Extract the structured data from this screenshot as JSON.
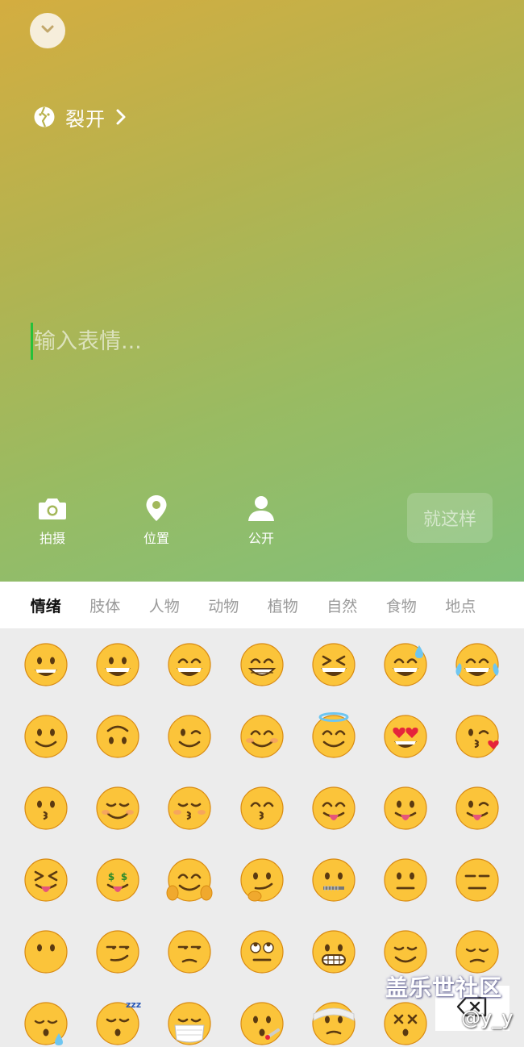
{
  "header": {
    "mood_name": "裂开"
  },
  "input": {
    "placeholder": "输入表情..."
  },
  "toolbar": {
    "camera_label": "拍摄",
    "location_label": "位置",
    "visibility_label": "公开",
    "submit_label": "就这样"
  },
  "tabs": [
    {
      "label": "情绪",
      "active": true
    },
    {
      "label": "肢体",
      "active": false
    },
    {
      "label": "人物",
      "active": false
    },
    {
      "label": "动物",
      "active": false
    },
    {
      "label": "植物",
      "active": false
    },
    {
      "label": "自然",
      "active": false
    },
    {
      "label": "食物",
      "active": false
    },
    {
      "label": "地点",
      "active": false
    }
  ],
  "emoji_rows": [
    [
      "grinning",
      "smiley",
      "smile",
      "grin",
      "laughing",
      "sweat-smile",
      "joy"
    ],
    [
      "slightly-smiling",
      "upside-down",
      "wink",
      "blush",
      "innocent",
      "heart-eyes",
      "kissing-heart"
    ],
    [
      "kissing",
      "relaxed",
      "kissing-closed-eyes",
      "kissing-smiling-eyes",
      "yum",
      "stuck-out-tongue",
      "stuck-out-tongue-winking"
    ],
    [
      "stuck-out-tongue-closed-eyes",
      "money-mouth",
      "hugging",
      "thinking",
      "zipper-mouth",
      "neutral",
      "expressionless"
    ],
    [
      "no-mouth",
      "smirk",
      "unamused",
      "rolling-eyes",
      "grimacing",
      "relieved",
      "pensive"
    ],
    [
      "sleepy",
      "sleeping",
      "mask",
      "thermometer-face",
      "head-bandage",
      "dizzy-face",
      ""
    ]
  ],
  "overlay": {
    "watermark_text": "盖乐世社区",
    "watermark_handle": "@y_y"
  },
  "colors": {
    "gradient_start": "#d4ad40",
    "gradient_end": "#82c07a",
    "caret": "#26c13a",
    "emoji_face": "#fbc43a",
    "emoji_outline": "#d88a12",
    "panel_bg": "#ececec"
  }
}
